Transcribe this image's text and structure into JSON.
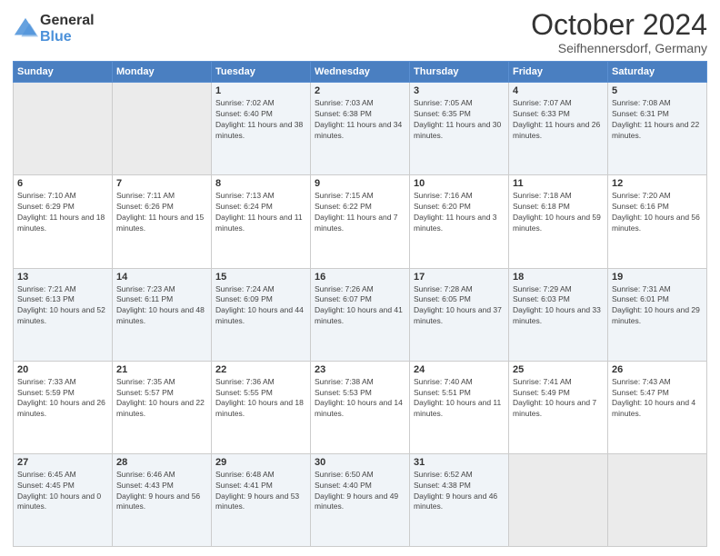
{
  "logo": {
    "general": "General",
    "blue": "Blue"
  },
  "header": {
    "month": "October 2024",
    "location": "Seifhennersdorf, Germany"
  },
  "weekdays": [
    "Sunday",
    "Monday",
    "Tuesday",
    "Wednesday",
    "Thursday",
    "Friday",
    "Saturday"
  ],
  "weeks": [
    [
      {
        "day": "",
        "sunrise": "",
        "sunset": "",
        "daylight": ""
      },
      {
        "day": "",
        "sunrise": "",
        "sunset": "",
        "daylight": ""
      },
      {
        "day": "1",
        "sunrise": "Sunrise: 7:02 AM",
        "sunset": "Sunset: 6:40 PM",
        "daylight": "Daylight: 11 hours and 38 minutes."
      },
      {
        "day": "2",
        "sunrise": "Sunrise: 7:03 AM",
        "sunset": "Sunset: 6:38 PM",
        "daylight": "Daylight: 11 hours and 34 minutes."
      },
      {
        "day": "3",
        "sunrise": "Sunrise: 7:05 AM",
        "sunset": "Sunset: 6:35 PM",
        "daylight": "Daylight: 11 hours and 30 minutes."
      },
      {
        "day": "4",
        "sunrise": "Sunrise: 7:07 AM",
        "sunset": "Sunset: 6:33 PM",
        "daylight": "Daylight: 11 hours and 26 minutes."
      },
      {
        "day": "5",
        "sunrise": "Sunrise: 7:08 AM",
        "sunset": "Sunset: 6:31 PM",
        "daylight": "Daylight: 11 hours and 22 minutes."
      }
    ],
    [
      {
        "day": "6",
        "sunrise": "Sunrise: 7:10 AM",
        "sunset": "Sunset: 6:29 PM",
        "daylight": "Daylight: 11 hours and 18 minutes."
      },
      {
        "day": "7",
        "sunrise": "Sunrise: 7:11 AM",
        "sunset": "Sunset: 6:26 PM",
        "daylight": "Daylight: 11 hours and 15 minutes."
      },
      {
        "day": "8",
        "sunrise": "Sunrise: 7:13 AM",
        "sunset": "Sunset: 6:24 PM",
        "daylight": "Daylight: 11 hours and 11 minutes."
      },
      {
        "day": "9",
        "sunrise": "Sunrise: 7:15 AM",
        "sunset": "Sunset: 6:22 PM",
        "daylight": "Daylight: 11 hours and 7 minutes."
      },
      {
        "day": "10",
        "sunrise": "Sunrise: 7:16 AM",
        "sunset": "Sunset: 6:20 PM",
        "daylight": "Daylight: 11 hours and 3 minutes."
      },
      {
        "day": "11",
        "sunrise": "Sunrise: 7:18 AM",
        "sunset": "Sunset: 6:18 PM",
        "daylight": "Daylight: 10 hours and 59 minutes."
      },
      {
        "day": "12",
        "sunrise": "Sunrise: 7:20 AM",
        "sunset": "Sunset: 6:16 PM",
        "daylight": "Daylight: 10 hours and 56 minutes."
      }
    ],
    [
      {
        "day": "13",
        "sunrise": "Sunrise: 7:21 AM",
        "sunset": "Sunset: 6:13 PM",
        "daylight": "Daylight: 10 hours and 52 minutes."
      },
      {
        "day": "14",
        "sunrise": "Sunrise: 7:23 AM",
        "sunset": "Sunset: 6:11 PM",
        "daylight": "Daylight: 10 hours and 48 minutes."
      },
      {
        "day": "15",
        "sunrise": "Sunrise: 7:24 AM",
        "sunset": "Sunset: 6:09 PM",
        "daylight": "Daylight: 10 hours and 44 minutes."
      },
      {
        "day": "16",
        "sunrise": "Sunrise: 7:26 AM",
        "sunset": "Sunset: 6:07 PM",
        "daylight": "Daylight: 10 hours and 41 minutes."
      },
      {
        "day": "17",
        "sunrise": "Sunrise: 7:28 AM",
        "sunset": "Sunset: 6:05 PM",
        "daylight": "Daylight: 10 hours and 37 minutes."
      },
      {
        "day": "18",
        "sunrise": "Sunrise: 7:29 AM",
        "sunset": "Sunset: 6:03 PM",
        "daylight": "Daylight: 10 hours and 33 minutes."
      },
      {
        "day": "19",
        "sunrise": "Sunrise: 7:31 AM",
        "sunset": "Sunset: 6:01 PM",
        "daylight": "Daylight: 10 hours and 29 minutes."
      }
    ],
    [
      {
        "day": "20",
        "sunrise": "Sunrise: 7:33 AM",
        "sunset": "Sunset: 5:59 PM",
        "daylight": "Daylight: 10 hours and 26 minutes."
      },
      {
        "day": "21",
        "sunrise": "Sunrise: 7:35 AM",
        "sunset": "Sunset: 5:57 PM",
        "daylight": "Daylight: 10 hours and 22 minutes."
      },
      {
        "day": "22",
        "sunrise": "Sunrise: 7:36 AM",
        "sunset": "Sunset: 5:55 PM",
        "daylight": "Daylight: 10 hours and 18 minutes."
      },
      {
        "day": "23",
        "sunrise": "Sunrise: 7:38 AM",
        "sunset": "Sunset: 5:53 PM",
        "daylight": "Daylight: 10 hours and 14 minutes."
      },
      {
        "day": "24",
        "sunrise": "Sunrise: 7:40 AM",
        "sunset": "Sunset: 5:51 PM",
        "daylight": "Daylight: 10 hours and 11 minutes."
      },
      {
        "day": "25",
        "sunrise": "Sunrise: 7:41 AM",
        "sunset": "Sunset: 5:49 PM",
        "daylight": "Daylight: 10 hours and 7 minutes."
      },
      {
        "day": "26",
        "sunrise": "Sunrise: 7:43 AM",
        "sunset": "Sunset: 5:47 PM",
        "daylight": "Daylight: 10 hours and 4 minutes."
      }
    ],
    [
      {
        "day": "27",
        "sunrise": "Sunrise: 6:45 AM",
        "sunset": "Sunset: 4:45 PM",
        "daylight": "Daylight: 10 hours and 0 minutes."
      },
      {
        "day": "28",
        "sunrise": "Sunrise: 6:46 AM",
        "sunset": "Sunset: 4:43 PM",
        "daylight": "Daylight: 9 hours and 56 minutes."
      },
      {
        "day": "29",
        "sunrise": "Sunrise: 6:48 AM",
        "sunset": "Sunset: 4:41 PM",
        "daylight": "Daylight: 9 hours and 53 minutes."
      },
      {
        "day": "30",
        "sunrise": "Sunrise: 6:50 AM",
        "sunset": "Sunset: 4:40 PM",
        "daylight": "Daylight: 9 hours and 49 minutes."
      },
      {
        "day": "31",
        "sunrise": "Sunrise: 6:52 AM",
        "sunset": "Sunset: 4:38 PM",
        "daylight": "Daylight: 9 hours and 46 minutes."
      },
      {
        "day": "",
        "sunrise": "",
        "sunset": "",
        "daylight": ""
      },
      {
        "day": "",
        "sunrise": "",
        "sunset": "",
        "daylight": ""
      }
    ]
  ]
}
